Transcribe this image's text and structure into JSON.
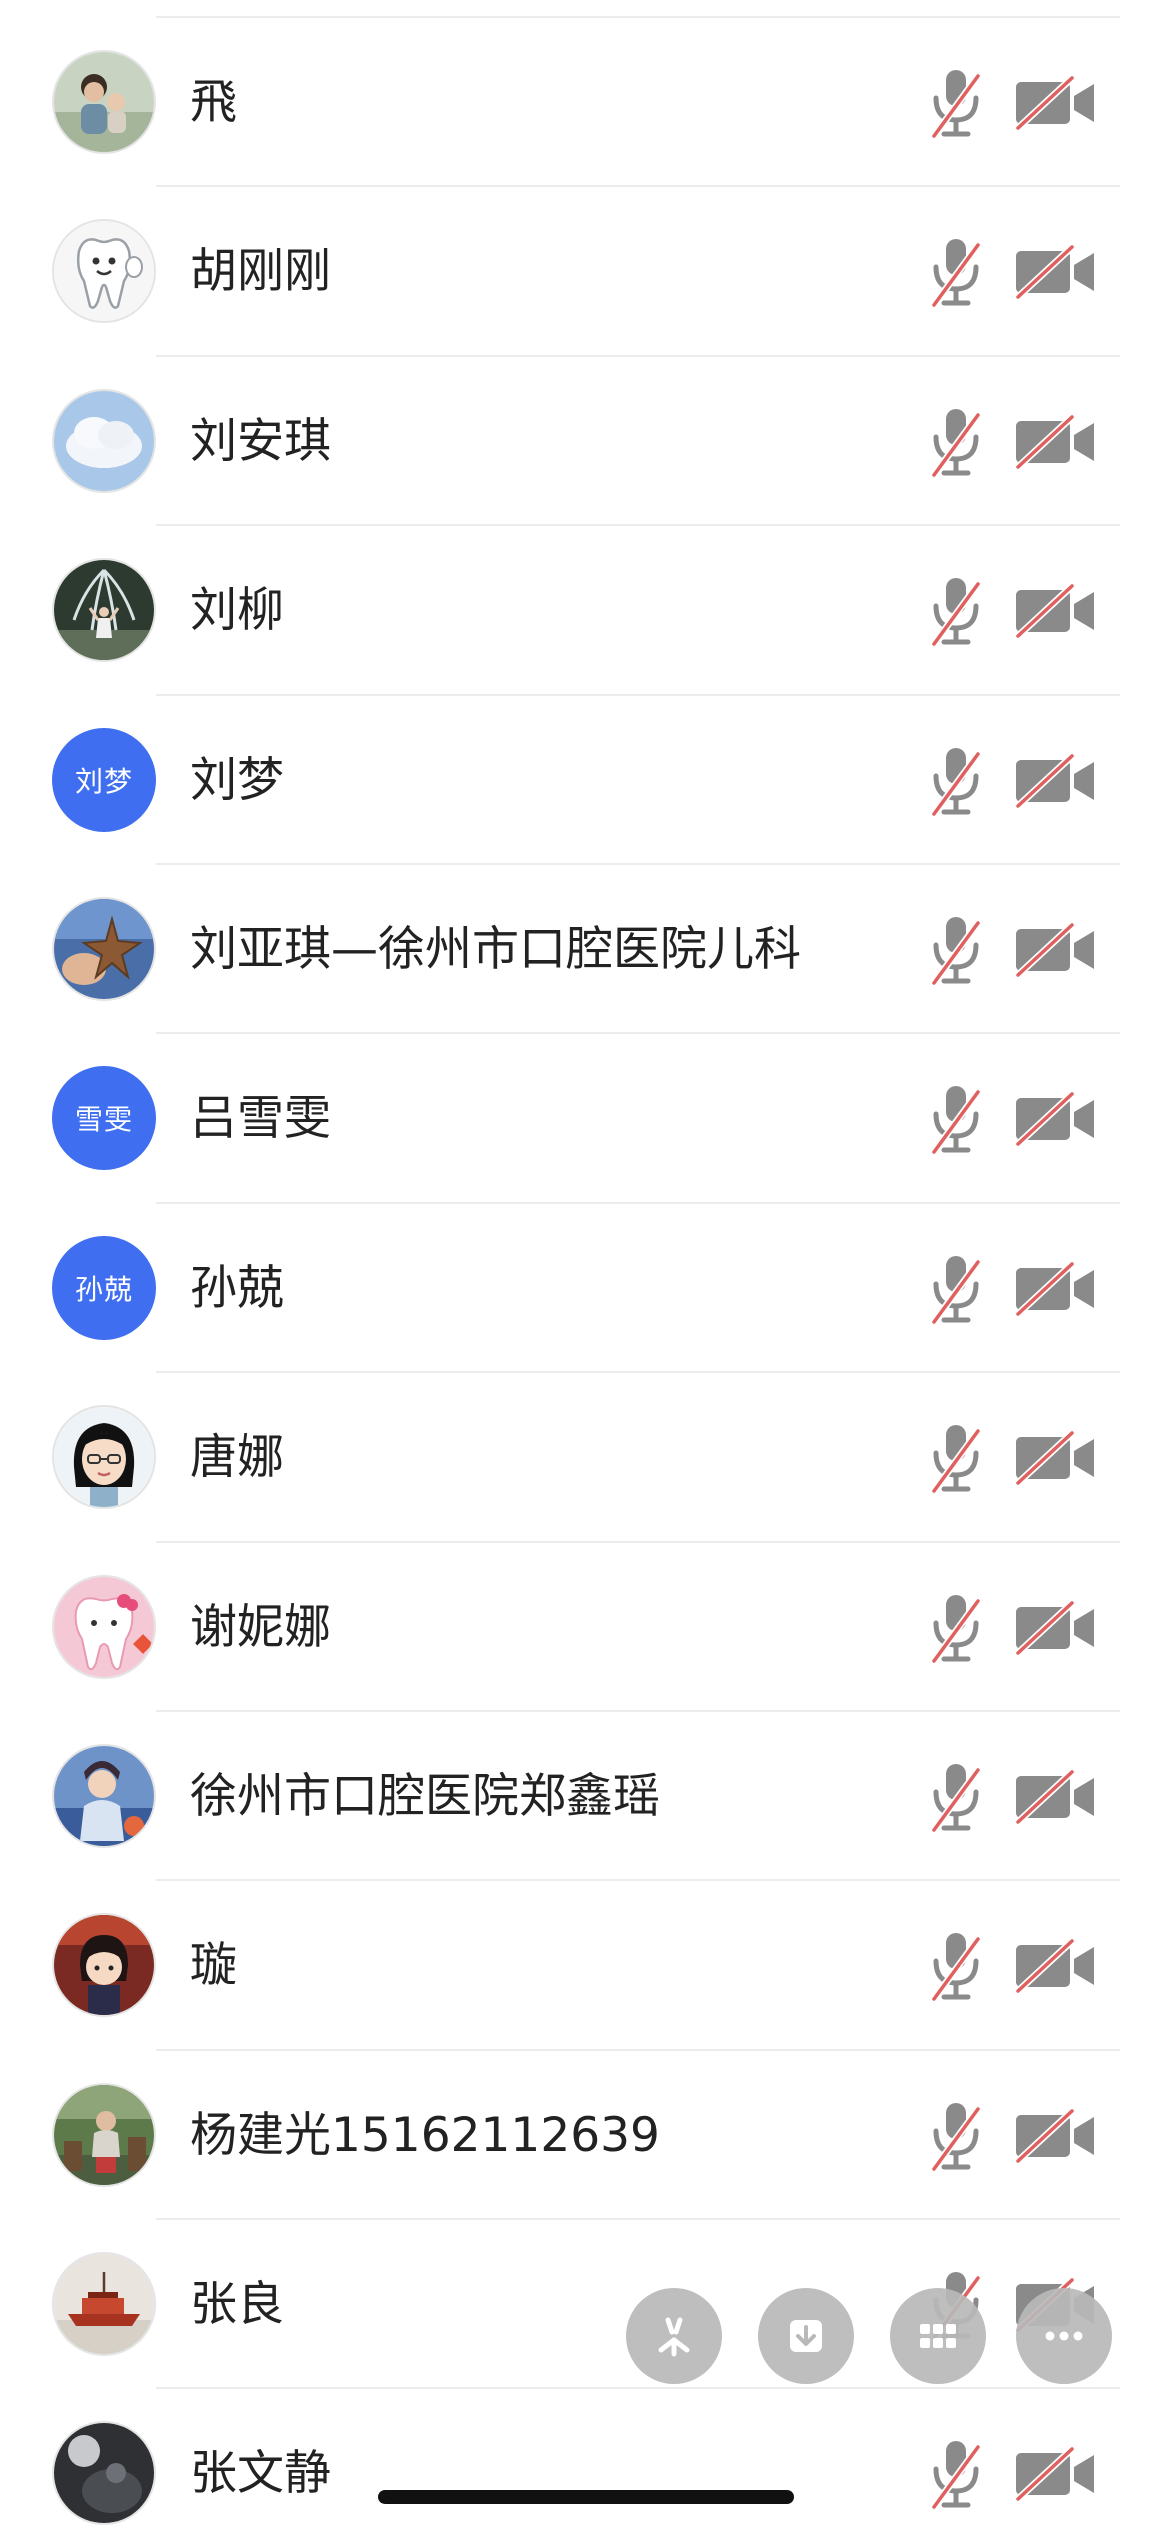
{
  "participants": [
    {
      "name": "飛",
      "avatar": {
        "type": "photo",
        "icon": "family-photo-avatar"
      },
      "mic": "muted",
      "camera": "off"
    },
    {
      "name": "胡刚刚",
      "avatar": {
        "type": "photo",
        "icon": "tooth-cartoon-avatar"
      },
      "mic": "muted",
      "camera": "off"
    },
    {
      "name": "刘安琪",
      "avatar": {
        "type": "photo",
        "icon": "cloud-sky-avatar"
      },
      "mic": "muted",
      "camera": "off"
    },
    {
      "name": "刘柳",
      "avatar": {
        "type": "photo",
        "icon": "fountain-person-avatar"
      },
      "mic": "muted",
      "camera": "off"
    },
    {
      "name": "刘梦",
      "avatar": {
        "type": "text",
        "text": "刘梦"
      },
      "mic": "muted",
      "camera": "off"
    },
    {
      "name": "刘亚琪—徐州市口腔医院儿科",
      "avatar": {
        "type": "photo",
        "icon": "starfish-hand-avatar"
      },
      "mic": "muted",
      "camera": "off"
    },
    {
      "name": "吕雪雯",
      "avatar": {
        "type": "text",
        "text": "雪雯"
      },
      "mic": "muted",
      "camera": "off"
    },
    {
      "name": "孙兢",
      "avatar": {
        "type": "text",
        "text": "孙兢"
      },
      "mic": "muted",
      "camera": "off"
    },
    {
      "name": "唐娜",
      "avatar": {
        "type": "photo",
        "icon": "cartoon-girl-avatar"
      },
      "mic": "muted",
      "camera": "off"
    },
    {
      "name": "谢妮娜",
      "avatar": {
        "type": "photo",
        "icon": "pink-tooth-avatar"
      },
      "mic": "muted",
      "camera": "off"
    },
    {
      "name": "徐州市口腔医院郑鑫瑶",
      "avatar": {
        "type": "photo",
        "icon": "costume-portrait-avatar"
      },
      "mic": "muted",
      "camera": "off"
    },
    {
      "name": "璇",
      "avatar": {
        "type": "photo",
        "icon": "anime-girl-avatar"
      },
      "mic": "muted",
      "camera": "off"
    },
    {
      "name": "杨建光15162112639",
      "avatar": {
        "type": "photo",
        "icon": "outdoor-man-avatar"
      },
      "mic": "muted",
      "camera": "off"
    },
    {
      "name": "张良",
      "avatar": {
        "type": "photo",
        "icon": "red-boat-avatar"
      },
      "mic": "muted",
      "camera": "off"
    },
    {
      "name": "张文静",
      "avatar": {
        "type": "photo",
        "icon": "dark-photo-avatar"
      },
      "mic": "muted",
      "camera": "off"
    }
  ],
  "floating_actions": [
    {
      "icon": "sparkle-icon",
      "label": "effects"
    },
    {
      "icon": "download-icon",
      "label": "save"
    },
    {
      "icon": "grid-icon",
      "label": "layout"
    },
    {
      "icon": "more-icon",
      "label": "more"
    }
  ],
  "colors": {
    "text": "#222222",
    "text_avatar_bg": "#3f6ff0",
    "icon_gray": "#8a8a8a",
    "muted_slash": "#e06060",
    "divider": "#ececec",
    "fab_bg": "#b9b9b9"
  }
}
